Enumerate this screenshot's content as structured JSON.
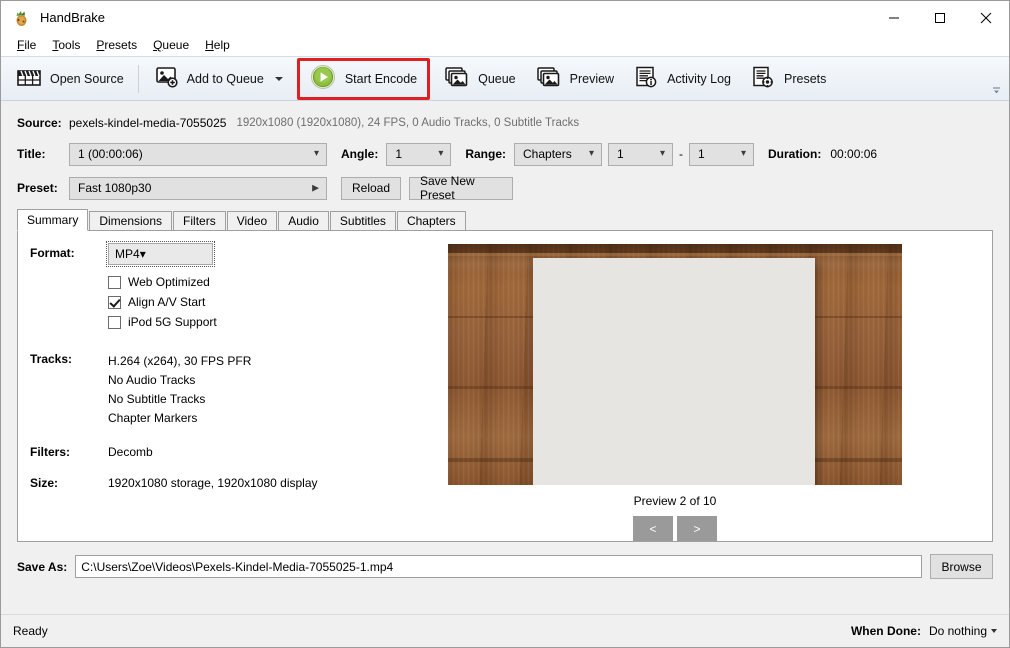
{
  "window": {
    "title": "HandBrake",
    "icon": "handbrake-pineapple-icon",
    "minimize": "—",
    "maximize": "□",
    "close": "✕"
  },
  "menubar": {
    "items": [
      {
        "label": "File",
        "mnemonic": "F"
      },
      {
        "label": "Tools",
        "mnemonic": "T"
      },
      {
        "label": "Presets",
        "mnemonic": "P"
      },
      {
        "label": "Queue",
        "mnemonic": "Q"
      },
      {
        "label": "Help",
        "mnemonic": "H"
      }
    ]
  },
  "toolbar": {
    "buttons": [
      {
        "label": "Open Source",
        "icon": "clapperboard-icon",
        "highlighted": false,
        "has_caret": false
      },
      {
        "label": "Add to Queue",
        "icon": "add-image-icon",
        "highlighted": false,
        "has_caret": true
      },
      {
        "label": "Start Encode",
        "icon": "green-play-icon",
        "highlighted": true,
        "has_caret": false
      },
      {
        "label": "Queue",
        "icon": "stacked-images-icon",
        "highlighted": false,
        "has_caret": false
      },
      {
        "label": "Preview",
        "icon": "preview-image-icon",
        "highlighted": false,
        "has_caret": false
      },
      {
        "label": "Activity Log",
        "icon": "log-info-icon",
        "highlighted": false,
        "has_caret": false
      },
      {
        "label": "Presets",
        "icon": "document-gear-icon",
        "highlighted": false,
        "has_caret": false
      }
    ],
    "highlight_color": "#e02020",
    "overflow_icon": "chevron-down-icon"
  },
  "source": {
    "label": "Source:",
    "name": "pexels-kindel-media-7055025",
    "meta": "1920x1080 (1920x1080), 24 FPS, 0 Audio Tracks, 0 Subtitle Tracks"
  },
  "title_row": {
    "label": "Title:",
    "value": "1  (00:00:06)",
    "angle_label": "Angle:",
    "angle_value": "1",
    "range_label": "Range:",
    "range_value": "Chapters",
    "range_start": "1",
    "range_dash": "-",
    "range_end": "1",
    "duration_label": "Duration:",
    "duration_value": "00:00:06"
  },
  "preset_row": {
    "label": "Preset:",
    "value": "Fast 1080p30",
    "expand_icon": "chevron-right-icon",
    "reload_label": "Reload",
    "save_label": "Save New Preset"
  },
  "tabs": [
    {
      "label": "Summary",
      "active": true
    },
    {
      "label": "Dimensions",
      "active": false
    },
    {
      "label": "Filters",
      "active": false
    },
    {
      "label": "Video",
      "active": false
    },
    {
      "label": "Audio",
      "active": false
    },
    {
      "label": "Subtitles",
      "active": false
    },
    {
      "label": "Chapters",
      "active": false
    }
  ],
  "summary": {
    "format_label": "Format:",
    "format_value": "MP4",
    "checkboxes": [
      {
        "label": "Web Optimized",
        "checked": false
      },
      {
        "label": "Align A/V Start",
        "checked": true
      },
      {
        "label": "iPod 5G Support",
        "checked": false
      }
    ],
    "tracks_label": "Tracks:",
    "tracks": [
      "H.264 (x264), 30 FPS PFR",
      "No Audio Tracks",
      "No Subtitle Tracks",
      "Chapter Markers"
    ],
    "filters_label": "Filters:",
    "filters_value": "Decomb",
    "size_label": "Size:",
    "size_value": "1920x1080 storage, 1920x1080 display"
  },
  "preview": {
    "caption": "Preview 2 of 10",
    "prev_label": "<",
    "next_label": ">",
    "image_description": "white-paper-on-wooden-table"
  },
  "save_as": {
    "label": "Save As:",
    "value": "C:\\Users\\Zoe\\Videos\\Pexels-Kindel-Media-7055025-1.mp4",
    "placeholder": "",
    "browse_label": "Browse"
  },
  "status": {
    "text": "Ready",
    "when_done_label": "When Done:",
    "when_done_value": "Do nothing"
  }
}
